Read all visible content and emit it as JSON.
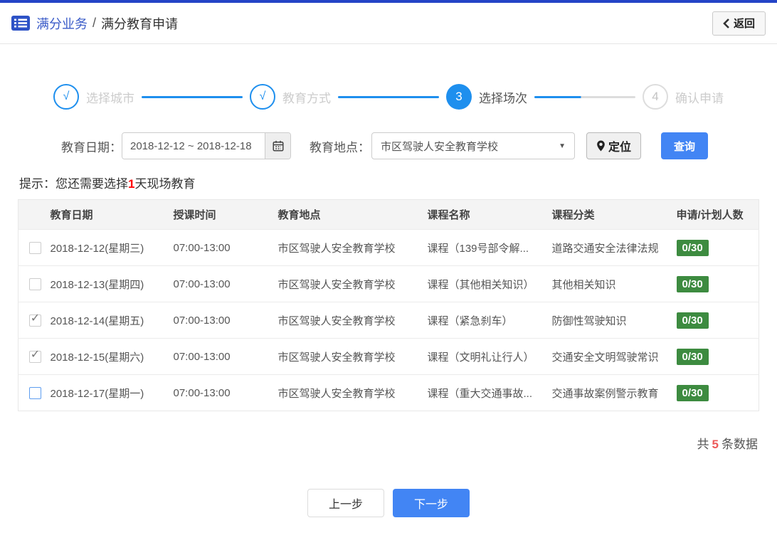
{
  "header": {
    "breadcrumb_primary": "满分业务",
    "breadcrumb_separator": "/",
    "breadcrumb_secondary": "满分教育申请",
    "back_button": "返回"
  },
  "stepper": {
    "steps": [
      {
        "mark": "√",
        "label": "选择城市",
        "state": "done"
      },
      {
        "mark": "√",
        "label": "教育方式",
        "state": "done"
      },
      {
        "mark": "3",
        "label": "选择场次",
        "state": "active"
      },
      {
        "mark": "4",
        "label": "确认申请",
        "state": "pending"
      }
    ]
  },
  "filters": {
    "date_label": "教育日期：",
    "date_value": "2018-12-12 ~ 2018-12-18",
    "location_label": "教育地点：",
    "location_value": "市区驾驶人安全教育学校",
    "locate_button": "定位",
    "query_button": "查询"
  },
  "hint": {
    "prefix": "提示：您还需要选择",
    "highlight": "1",
    "suffix": "天现场教育"
  },
  "table": {
    "headers": [
      "教育日期",
      "授课时间",
      "教育地点",
      "课程名称",
      "课程分类",
      "申请/计划人数"
    ],
    "rows": [
      {
        "checked": false,
        "focused": false,
        "date": "2018-12-12(星期三)",
        "time": "07:00-13:00",
        "place": "市区驾驶人安全教育学校",
        "course": "课程（139号部令解...",
        "category": "道路交通安全法律法规",
        "count": "0/30"
      },
      {
        "checked": false,
        "focused": false,
        "date": "2018-12-13(星期四)",
        "time": "07:00-13:00",
        "place": "市区驾驶人安全教育学校",
        "course": "课程（其他相关知识）",
        "category": "其他相关知识",
        "count": "0/30"
      },
      {
        "checked": true,
        "focused": false,
        "date": "2018-12-14(星期五)",
        "time": "07:00-13:00",
        "place": "市区驾驶人安全教育学校",
        "course": "课程（紧急刹车）",
        "category": "防御性驾驶知识",
        "count": "0/30"
      },
      {
        "checked": true,
        "focused": false,
        "date": "2018-12-15(星期六)",
        "time": "07:00-13:00",
        "place": "市区驾驶人安全教育学校",
        "course": "课程（文明礼让行人）",
        "category": "交通安全文明驾驶常识",
        "count": "0/30"
      },
      {
        "checked": false,
        "focused": true,
        "date": "2018-12-17(星期一)",
        "time": "07:00-13:00",
        "place": "市区驾驶人安全教育学校",
        "course": "课程（重大交通事故...",
        "category": "交通事故案例警示教育",
        "count": "0/30"
      }
    ]
  },
  "summary": {
    "prefix": "共",
    "count": "5",
    "suffix": "条数据"
  },
  "actions": {
    "prev": "上一步",
    "next": "下一步"
  },
  "colors": {
    "brand_blue": "#2444c7",
    "step_blue": "#1e8fee",
    "accent_blue": "#4285f4",
    "badge_green": "#3d8b40",
    "alert_red": "#ff0000",
    "count_red": "#ed5a5a"
  }
}
